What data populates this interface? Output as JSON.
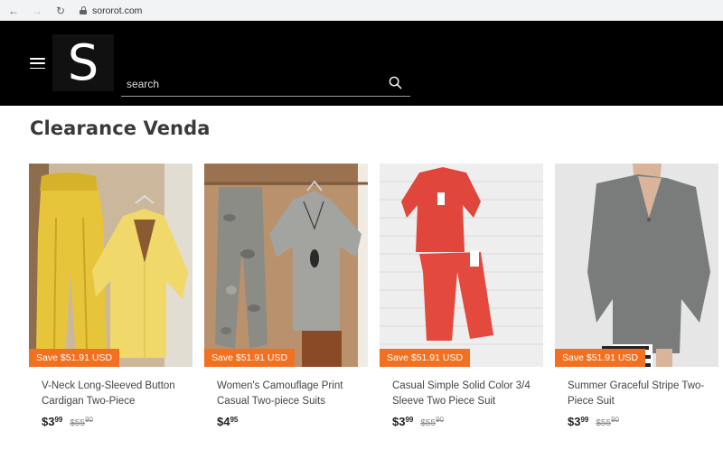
{
  "browser": {
    "url": "sororot.com"
  },
  "header": {
    "logo_letter": "S",
    "search_placeholder": "search"
  },
  "main": {
    "title": "Clearance Venda",
    "products": [
      {
        "badge": "Save $51.91 USD",
        "title": "V-Neck Long-Sleeved Button Cardigan Two-Piece",
        "price_whole": "$3",
        "price_cents": "99",
        "old_whole": "$55",
        "old_cents": "90",
        "colors": {
          "primary": "#e6c63a",
          "secondary": "#d9b52a",
          "bg": "#c9b79a"
        }
      },
      {
        "badge": "Save $51.91 USD",
        "title": "Women's Camouflage Print Casual Two-piece Suits",
        "price_whole": "$4",
        "price_cents": "95",
        "old_whole": "",
        "old_cents": "",
        "colors": {
          "primary": "#8a8a86",
          "secondary": "#a0a09b",
          "bg": "#b58d6a"
        }
      },
      {
        "badge": "Save $51.91 USD",
        "title": "Casual Simple Solid Color 3/4 Sleeve Two Piece Suit",
        "price_whole": "$3",
        "price_cents": "99",
        "old_whole": "$55",
        "old_cents": "90",
        "colors": {
          "primary": "#e2453a",
          "secondary": "#d63b31",
          "bg": "#efefef"
        }
      },
      {
        "badge": "Save $51.91 USD",
        "title": "Summer Graceful Stripe Two-Piece Suit",
        "price_whole": "$3",
        "price_cents": "99",
        "old_whole": "$55",
        "old_cents": "90",
        "colors": {
          "primary": "#7b7e7c",
          "secondary": "#6c6f6d",
          "bg": "#e8e8e8"
        }
      }
    ]
  }
}
